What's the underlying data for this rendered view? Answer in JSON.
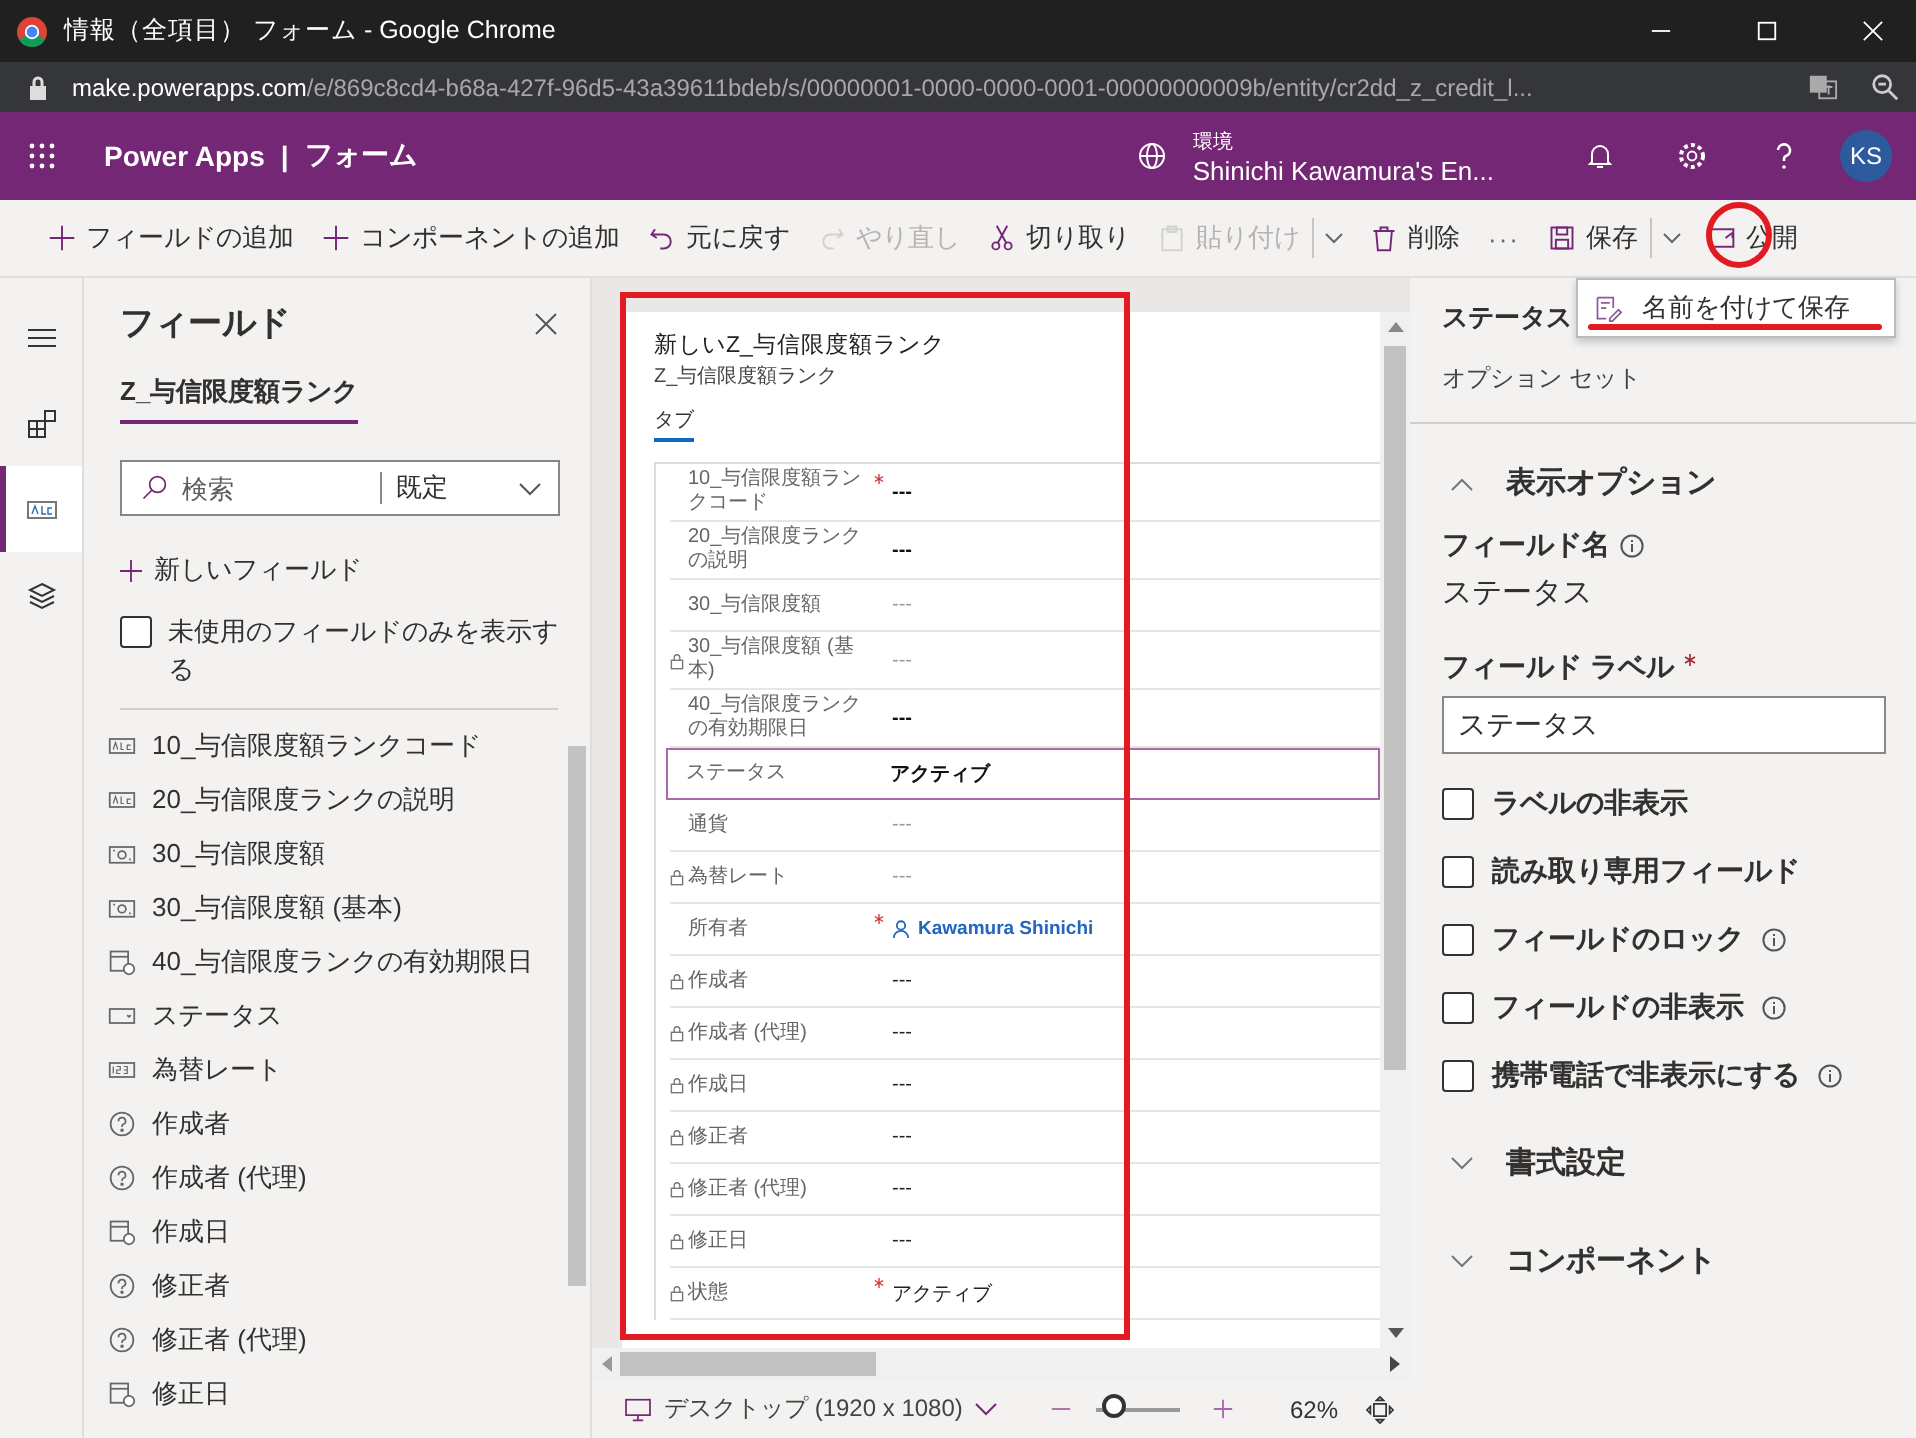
{
  "window": {
    "title": "情報（全項目） フォーム - Google Chrome"
  },
  "address_bar": {
    "host": "make.powerapps.com",
    "path": "/e/869c8cd4-b68a-427f-96d5-43a39611bdeb/s/00000001-0000-0000-0001-00000000009b/entity/cr2dd_z_credit_l..."
  },
  "header": {
    "app_name": "Power Apps",
    "separator": "|",
    "page": "フォーム",
    "environment_label": "環境",
    "environment": "Shinichi Kawamura's En...",
    "avatar": "KS"
  },
  "command_bar": [
    {
      "kind": "add",
      "label": "フィールドの追加",
      "disabled": false
    },
    {
      "kind": "add",
      "label": "コンポーネントの追加",
      "disabled": false
    },
    {
      "kind": "undo",
      "label": "元に戻す",
      "disabled": false
    },
    {
      "kind": "redo",
      "label": "やり直し",
      "disabled": true
    },
    {
      "kind": "cut",
      "label": "切り取り",
      "disabled": false
    },
    {
      "kind": "paste",
      "label": "貼り付け",
      "disabled": true
    },
    {
      "kind": "split",
      "disabled": false
    },
    {
      "kind": "delete",
      "label": "削除",
      "disabled": false
    },
    {
      "kind": "more",
      "label": "···",
      "disabled": false
    },
    {
      "kind": "save",
      "label": "保存",
      "disabled": false
    },
    {
      "kind": "split",
      "disabled": false
    },
    {
      "kind": "publish",
      "label": "公開",
      "disabled": false
    }
  ],
  "save_menu": {
    "item": "名前を付けて保存"
  },
  "rail": [
    {
      "kind": "menu",
      "selected": false
    },
    {
      "kind": "components",
      "selected": false
    },
    {
      "kind": "fields",
      "selected": true
    },
    {
      "kind": "layers",
      "selected": false
    }
  ],
  "fields_panel": {
    "title": "フィールド",
    "tab": "Z_与信限度額ランク",
    "search_placeholder": "検索",
    "filter": "既定",
    "new_field": "新しいフィールド",
    "unused_only": {
      "label": "未使用のフィールドのみを表示する",
      "checked": false
    },
    "items": [
      {
        "kind": "text",
        "label": "10_与信限度額ランクコード"
      },
      {
        "kind": "text",
        "label": "20_与信限度ランクの説明"
      },
      {
        "kind": "currency",
        "label": "30_与信限度額"
      },
      {
        "kind": "currency",
        "label": "30_与信限度額 (基本)"
      },
      {
        "kind": "date",
        "label": "40_与信限度ランクの有効期限日"
      },
      {
        "kind": "option",
        "label": "ステータス"
      },
      {
        "kind": "number",
        "label": "為替レート"
      },
      {
        "kind": "lookup",
        "label": "作成者"
      },
      {
        "kind": "lookup",
        "label": "作成者 (代理)"
      },
      {
        "kind": "date",
        "label": "作成日"
      },
      {
        "kind": "lookup",
        "label": "修正者"
      },
      {
        "kind": "lookup",
        "label": "修正者 (代理)"
      },
      {
        "kind": "date",
        "label": "修正日"
      }
    ]
  },
  "form": {
    "title": "新しいZ_与信限度額ランク",
    "subtitle": "Z_与信限度額ランク",
    "tab": "タブ",
    "rows": [
      {
        "label": "10_与信限度額ランクコード",
        "required": true,
        "locked": false,
        "value": "---",
        "kind": "strong",
        "selected": false
      },
      {
        "label": "20_与信限度ランクの説明",
        "required": false,
        "locked": false,
        "value": "---",
        "kind": "strong",
        "selected": false
      },
      {
        "label": "30_与信限度額",
        "required": false,
        "locked": false,
        "value": "---",
        "kind": "muted",
        "selected": false
      },
      {
        "label": "30_与信限度額 (基本)",
        "required": false,
        "locked": true,
        "value": "---",
        "kind": "muted",
        "selected": false
      },
      {
        "label": "40_与信限度ランクの有効期限日",
        "required": false,
        "locked": false,
        "value": "---",
        "kind": "strong",
        "selected": false
      },
      {
        "label": "ステータス",
        "required": false,
        "locked": false,
        "value": "アクティブ",
        "kind": "strong",
        "selected": true
      },
      {
        "label": "通貨",
        "required": false,
        "locked": false,
        "value": "---",
        "kind": "muted",
        "selected": false
      },
      {
        "label": "為替レート",
        "required": false,
        "locked": true,
        "value": "---",
        "kind": "muted",
        "selected": false
      },
      {
        "label": "所有者",
        "required": true,
        "locked": false,
        "value": "Kawamura Shinichi",
        "kind": "lookup",
        "selected": false
      },
      {
        "label": "作成者",
        "required": false,
        "locked": true,
        "value": "---",
        "kind": "plain",
        "selected": false
      },
      {
        "label": "作成者 (代理)",
        "required": false,
        "locked": true,
        "value": "---",
        "kind": "plain",
        "selected": false
      },
      {
        "label": "作成日",
        "required": false,
        "locked": true,
        "value": "---",
        "kind": "plain",
        "selected": false
      },
      {
        "label": "修正者",
        "required": false,
        "locked": true,
        "value": "---",
        "kind": "plain",
        "selected": false
      },
      {
        "label": "修正者 (代理)",
        "required": false,
        "locked": true,
        "value": "---",
        "kind": "plain",
        "selected": false
      },
      {
        "label": "修正日",
        "required": false,
        "locked": true,
        "value": "---",
        "kind": "plain",
        "selected": false
      },
      {
        "label": "状態",
        "required": true,
        "locked": true,
        "value": "アクティブ",
        "kind": "plain",
        "selected": false
      }
    ]
  },
  "canvas_footer": {
    "device": "デスクトップ (1920 x 1080)",
    "zoom": "62%",
    "zoom_slider": {
      "level": 0.05
    }
  },
  "properties_panel": {
    "title": "ステータス",
    "type": "オプション セット",
    "display_options": {
      "title": "表示オプション",
      "expanded": true,
      "field_name_label": "フィールド名",
      "field_name": "ステータス",
      "field_label_label": "フィールド ラベル",
      "field_label_required": true,
      "field_label_value": "ステータス",
      "checkboxes": [
        {
          "label": "ラベルの非表示",
          "checked": false,
          "info": false
        },
        {
          "label": "読み取り専用フィールド",
          "checked": false,
          "info": false
        },
        {
          "label": "フィールドのロック",
          "checked": false,
          "info": true
        },
        {
          "label": "フィールドの非表示",
          "checked": false,
          "info": true
        },
        {
          "label": "携帯電話で非表示にする",
          "checked": false,
          "info": true
        }
      ]
    },
    "sections": [
      {
        "title": "書式設定",
        "expanded": false
      },
      {
        "title": "コンポーネント",
        "expanded": false
      }
    ]
  }
}
